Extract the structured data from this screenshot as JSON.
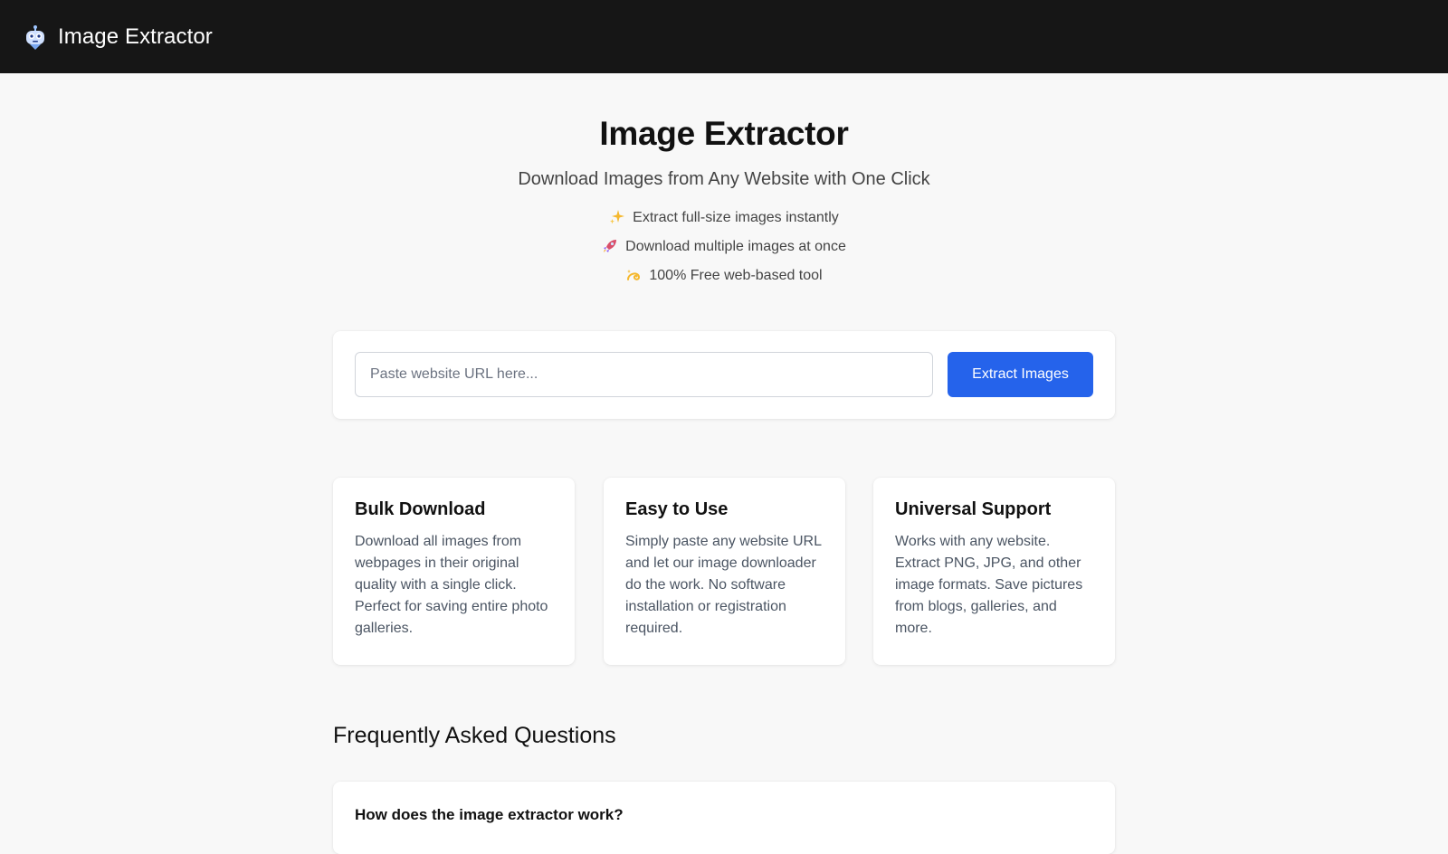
{
  "header": {
    "brand": "Image Extractor",
    "logo_icon": "robot-icon"
  },
  "hero": {
    "title": "Image Extractor",
    "subtitle": "Download Images from Any Website with One Click",
    "features": [
      {
        "icon": "sparkles-icon",
        "text": "Extract full-size images instantly"
      },
      {
        "icon": "rocket-icon",
        "text": "Download multiple images at once"
      },
      {
        "icon": "dizzy-icon",
        "text": "100% Free web-based tool"
      }
    ]
  },
  "search": {
    "placeholder": "Paste website URL here...",
    "value": "",
    "button_label": "Extract Images"
  },
  "cards": [
    {
      "title": "Bulk Download",
      "text": "Download all images from webpages in their original quality with a single click. Perfect for saving entire photo galleries."
    },
    {
      "title": "Easy to Use",
      "text": "Simply paste any website URL and let our image downloader do the work. No software installation or registration required."
    },
    {
      "title": "Universal Support",
      "text": "Works with any website. Extract PNG, JPG, and other image formats. Save pictures from blogs, galleries, and more."
    }
  ],
  "faq": {
    "title": "Frequently Asked Questions",
    "items": [
      {
        "question": "How does the image extractor work?"
      }
    ]
  },
  "colors": {
    "accent": "#2563eb",
    "header_bg": "#161616",
    "page_bg": "#f8f8f8"
  }
}
